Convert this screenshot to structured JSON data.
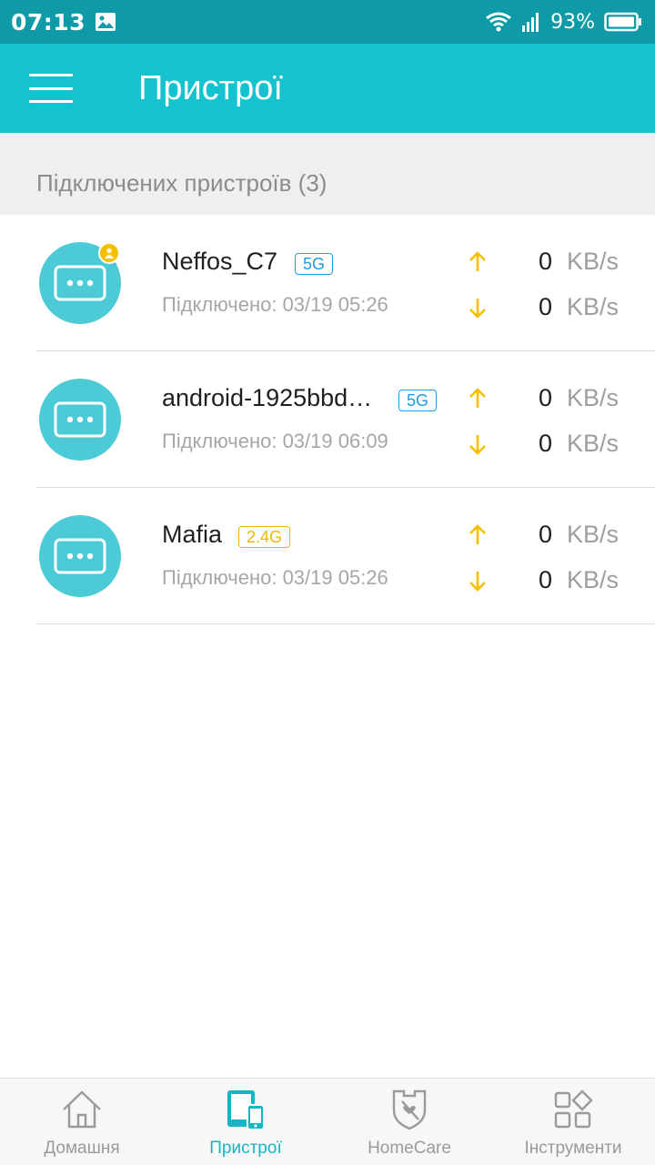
{
  "status_bar": {
    "time": "07:13",
    "battery": "93%"
  },
  "app_bar": {
    "title": "Пристрої"
  },
  "section": {
    "header": "Підключених пристроїв (3)"
  },
  "devices": [
    {
      "name": "Neffos_C7",
      "band": "5G",
      "connected": "Підключено: 03/19 05:26",
      "up_value": "0",
      "up_unit": "KB/s",
      "down_value": "0",
      "down_unit": "KB/s"
    },
    {
      "name": "android-1925bbd…",
      "band": "5G",
      "connected": "Підключено: 03/19 06:09",
      "up_value": "0",
      "up_unit": "KB/s",
      "down_value": "0",
      "down_unit": "KB/s"
    },
    {
      "name": "Mafia",
      "band": "2.4G",
      "connected": "Підключено: 03/19 05:26",
      "up_value": "0",
      "up_unit": "KB/s",
      "down_value": "0",
      "down_unit": "KB/s"
    }
  ],
  "bottom_nav": {
    "items": [
      {
        "label": "Домашня",
        "icon": "home-icon"
      },
      {
        "label": "Пристрої",
        "icon": "devices-icon"
      },
      {
        "label": "HomeCare",
        "icon": "shield-icon"
      },
      {
        "label": "Інструменти",
        "icon": "tools-icon"
      }
    ]
  },
  "colors": {
    "status_bar": "#0e9aa6",
    "app_bar": "#14c3cf",
    "accent": "#14b6c4",
    "band_5g": "#1e9be0",
    "band_24g": "#f2b600",
    "arrow": "#f5c000"
  }
}
